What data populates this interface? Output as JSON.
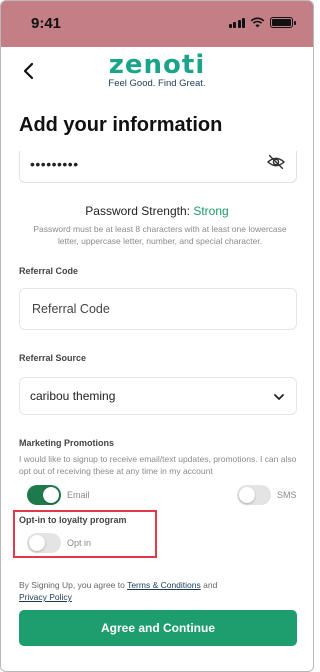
{
  "status_bar": {
    "time": "9:41",
    "background": "#c47f86"
  },
  "header": {
    "back_icon": "chevron-left-icon",
    "logo_text": "zenoti",
    "logo_tagline": "Feel Good. Find Great.",
    "brand_color": "#1aa58a"
  },
  "page": {
    "title": "Add your information"
  },
  "password": {
    "masked_value": "•••••••••",
    "visibility_icon": "eye-slash-icon",
    "strength_label": "Password Strength:",
    "strength_value": "Strong",
    "strength_color": "#1b9b6a",
    "hint": "Password must be at least 8 characters with at least one lowercase letter, uppercase letter, number, and special character."
  },
  "referral_code": {
    "label": "Referral Code",
    "placeholder": "Referral Code"
  },
  "referral_source": {
    "label": "Referral Source",
    "selected": "caribou theming"
  },
  "marketing": {
    "label": "Marketing Promotions",
    "description": "I would like to signup to receive email/text updates, promotions. I can also opt out of receiving these at any time in my account",
    "email_label": "Email",
    "email_on": true,
    "sms_label": "SMS",
    "sms_on": false
  },
  "loyalty": {
    "label": "Opt-in to loyalty program",
    "toggle_label": "Opt in",
    "on": false
  },
  "agreement": {
    "prefix": "By Signing Up, you agree to",
    "terms_link": "Terms & Conditions",
    "conjunction": "and",
    "privacy_link": "Privacy Policy"
  },
  "primary_button": {
    "label": "Agree and Continue",
    "color": "#1e9e6e"
  }
}
